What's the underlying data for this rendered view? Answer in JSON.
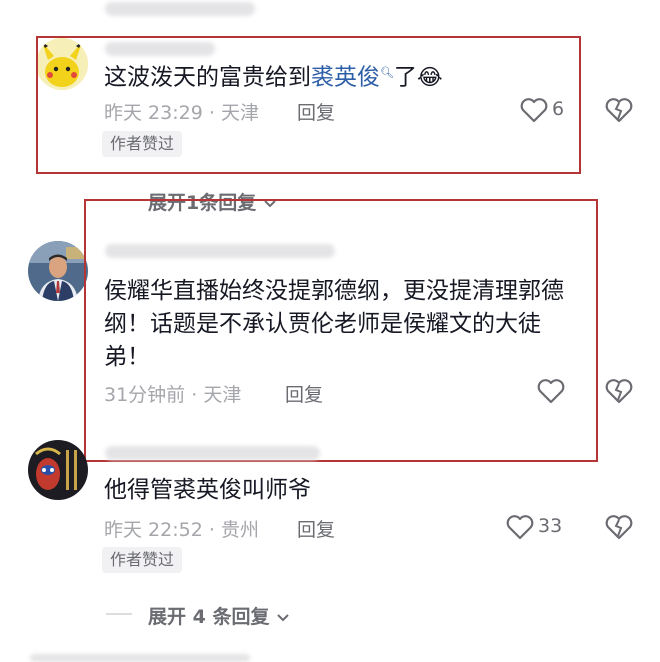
{
  "comments": [
    {
      "text_plain": "这波泼天的富贵给到",
      "text_link": "裘英俊",
      "text_after": "了",
      "emoji": "😂",
      "time": "昨天 23:29",
      "location": "天津",
      "reply_label": "回复",
      "likes": "6",
      "badge": "作者赞过"
    },
    {
      "text_lines": [
        "侯耀华直播始终没提郭德纲，更没提清理郭德",
        "纲！话题是不承认贾伦老师是侯耀文的大徒",
        "弟！"
      ],
      "time": "31分钟前",
      "location": "天津",
      "reply_label": "回复"
    },
    {
      "text_plain": "他得管裘英俊叫师爷",
      "time": "昨天 22:52",
      "location": "贵州",
      "reply_label": "回复",
      "likes": "33",
      "badge": "作者赞过"
    }
  ],
  "expand_1": "展开1条回复",
  "expand_2": "展开 4 条回复",
  "dot": "·",
  "colors": {
    "highlight_box": "#b53436",
    "link": "#2d5fa8",
    "meta": "#a5a6ab"
  }
}
